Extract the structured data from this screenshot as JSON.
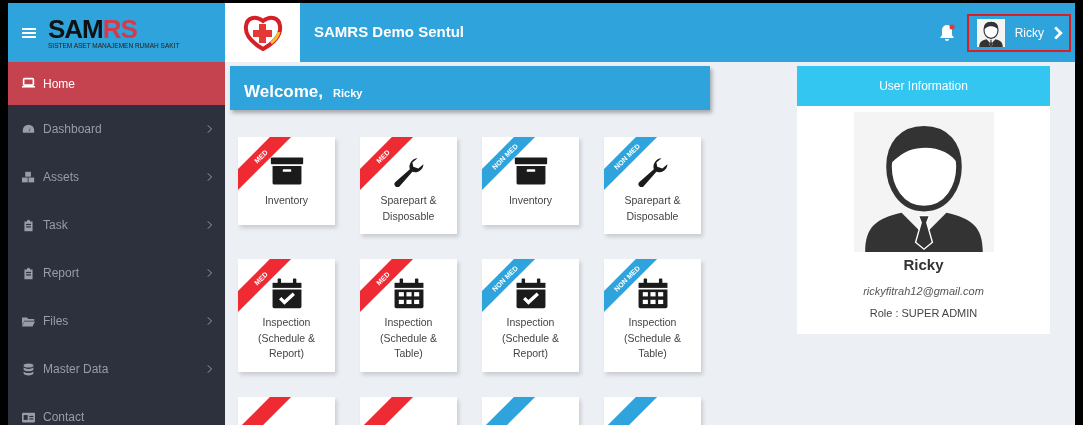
{
  "header": {
    "brand_main": "SAM",
    "brand_accent": "RS",
    "brand_tagline": "SISTEM ASET MANAJEMEN RUMAH SAKIT",
    "title": "SAMRS Demo Sentul",
    "notification_unread": true,
    "user_name": "Ricky",
    "highlighted": true
  },
  "sidebar": {
    "items": [
      {
        "label": "Home",
        "selected": true,
        "has_submenu": false
      },
      {
        "label": "Dashboard",
        "selected": false,
        "has_submenu": true
      },
      {
        "label": "Assets",
        "selected": false,
        "has_submenu": true
      },
      {
        "label": "Task",
        "selected": false,
        "has_submenu": true
      },
      {
        "label": "Report",
        "selected": false,
        "has_submenu": true
      },
      {
        "label": "Files",
        "selected": false,
        "has_submenu": true
      },
      {
        "label": "Master Data",
        "selected": false,
        "has_submenu": true
      },
      {
        "label": "Contact",
        "selected": false,
        "has_submenu": false
      }
    ]
  },
  "welcome": {
    "greeting": "Welcome,",
    "name": "Ricky"
  },
  "tiles": [
    {
      "ribbon": "MED",
      "kind": "med",
      "label": "Inventory"
    },
    {
      "ribbon": "MED",
      "kind": "med",
      "label": "Sparepart & Disposable"
    },
    {
      "ribbon": "NON MED",
      "kind": "nonmed",
      "label": "Inventory"
    },
    {
      "ribbon": "NON MED",
      "kind": "nonmed",
      "label": "Sparepart & Disposable"
    },
    {
      "ribbon": "MED",
      "kind": "med",
      "label": "Inspection (Schedule & Report)"
    },
    {
      "ribbon": "MED",
      "kind": "med",
      "label": "Inspection (Schedule & Table)"
    },
    {
      "ribbon": "NON MED",
      "kind": "nonmed",
      "label": "Inspection (Schedule & Report)"
    },
    {
      "ribbon": "NON MED",
      "kind": "nonmed",
      "label": "Inspection (Schedule & Table)"
    },
    {
      "kind": "med"
    },
    {
      "kind": "med"
    },
    {
      "kind": "nonmed"
    },
    {
      "kind": "nonmed"
    }
  ],
  "user_info": {
    "title": "User Information",
    "name": "Ricky",
    "email": "rickyfitrah12@gmail.com",
    "role": "Role : SUPER ADMIN"
  }
}
